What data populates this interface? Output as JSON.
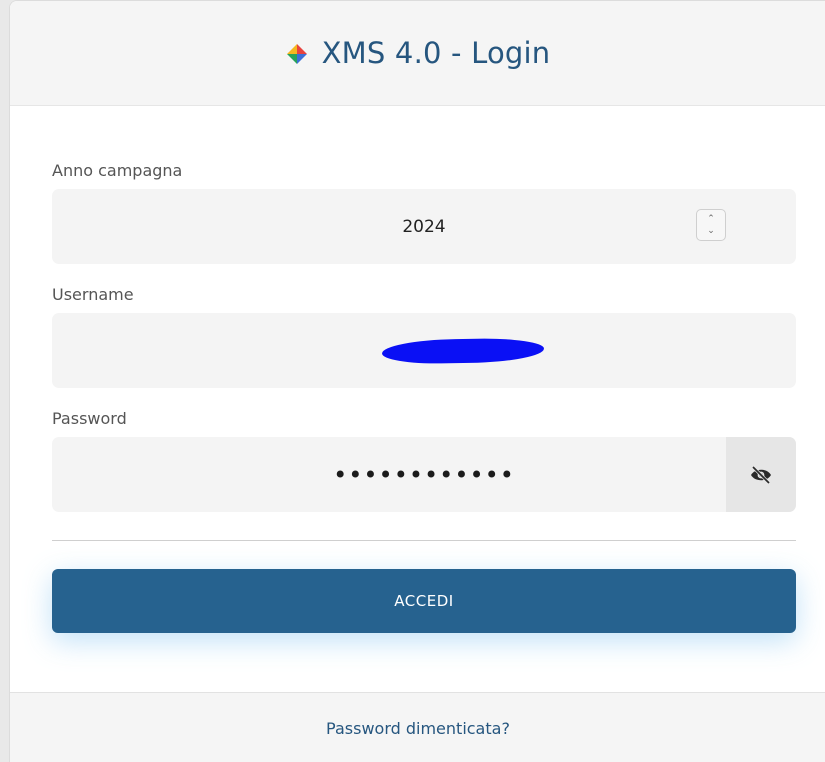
{
  "header": {
    "title": "XMS 4.0 - Login",
    "logo_icon": "diamond-logo-icon",
    "logo_colors": [
      "#e8433f",
      "#f5b71f",
      "#27a35a",
      "#3b6fd8"
    ]
  },
  "form": {
    "year": {
      "label": "Anno campagna",
      "value": "2024",
      "icon": "up-down-spinner-icon"
    },
    "username": {
      "label": "Username",
      "value": "[redacted]",
      "redaction_color": "#0a10f5"
    },
    "password": {
      "label": "Password",
      "value": "••••••••••••",
      "toggle_icon": "eye-slash-icon"
    }
  },
  "submit": {
    "label": "ACCEDI",
    "color": "#26628f"
  },
  "footer": {
    "forgot_label": "Password dimenticata?"
  }
}
